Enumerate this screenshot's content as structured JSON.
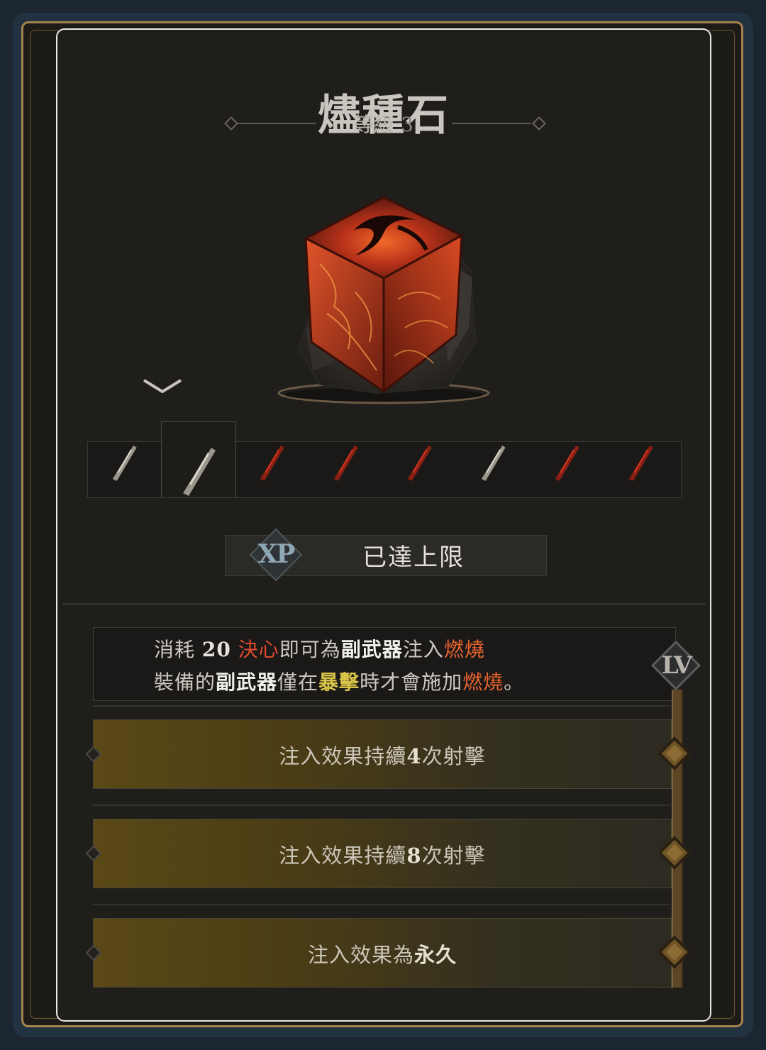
{
  "item": {
    "name": "燼種石",
    "level_label": "等級",
    "level_value": "3"
  },
  "weapons": {
    "selected_index": 1,
    "items": [
      {
        "name": "weapon-1",
        "tone": "silver"
      },
      {
        "name": "weapon-2",
        "tone": "silver"
      },
      {
        "name": "weapon-3",
        "tone": "red"
      },
      {
        "name": "weapon-4",
        "tone": "red"
      },
      {
        "name": "weapon-5",
        "tone": "red"
      },
      {
        "name": "weapon-6",
        "tone": "silver"
      },
      {
        "name": "weapon-7",
        "tone": "red"
      },
      {
        "name": "weapon-8",
        "tone": "red"
      }
    ]
  },
  "xp": {
    "badge": "XP",
    "status": "已達上限"
  },
  "description": {
    "line1": [
      {
        "t": "消耗 ",
        "c": "normal"
      },
      {
        "t": "20",
        "c": "num"
      },
      {
        "t": " 決心",
        "c": "red"
      },
      {
        "t": "即可為",
        "c": "normal"
      },
      {
        "t": "副武器",
        "c": "white"
      },
      {
        "t": "注入",
        "c": "normal"
      },
      {
        "t": "燃燒",
        "c": "orange"
      }
    ],
    "line2": [
      {
        "t": "裝備的",
        "c": "normal"
      },
      {
        "t": "副武器",
        "c": "white"
      },
      {
        "t": "僅在",
        "c": "normal"
      },
      {
        "t": "暴擊",
        "c": "yellow"
      },
      {
        "t": "時才會施加",
        "c": "normal"
      },
      {
        "t": "燃燒",
        "c": "orange"
      },
      {
        "t": "。",
        "c": "normal"
      }
    ]
  },
  "level_badge": "LV",
  "tiers": [
    {
      "pre": "注入效果持續",
      "bold": "4",
      "post": "次射擊"
    },
    {
      "pre": "注入效果持續",
      "bold": "8",
      "post": "次射擊"
    },
    {
      "pre": "注入效果為",
      "bold": "永久",
      "post": ""
    }
  ],
  "colors": {
    "gold": "#a6834c",
    "burn": "#e8632f",
    "crit": "#d9c44a",
    "panel": "#1f1e1b"
  }
}
